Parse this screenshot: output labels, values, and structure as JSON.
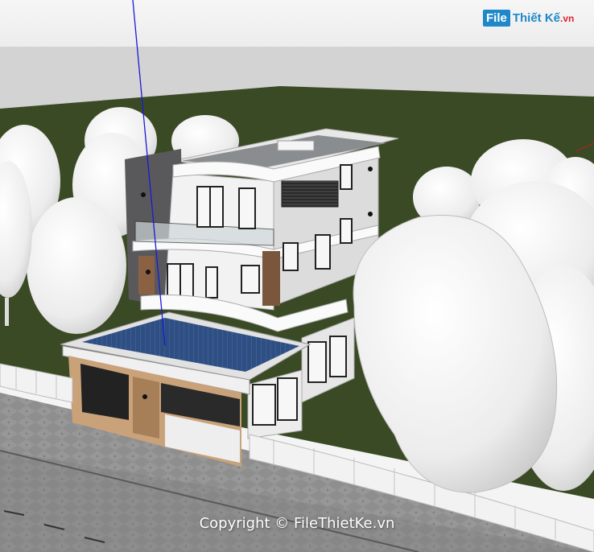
{
  "logo": {
    "box_text": "File",
    "main_text": "Thiết Kế",
    "domain_text": ".vn",
    "brand_color": "#1e88c9"
  },
  "watermark": {
    "text": "Copyright © FileThietKe.vn"
  },
  "palette": {
    "sky": "#f3f3f3",
    "horizon": "#d3d3d3",
    "lawn": "#3a4a25",
    "road": "#8c8c8c",
    "roof_panel": "#2f4f83",
    "tree": "#f0f0f0"
  }
}
